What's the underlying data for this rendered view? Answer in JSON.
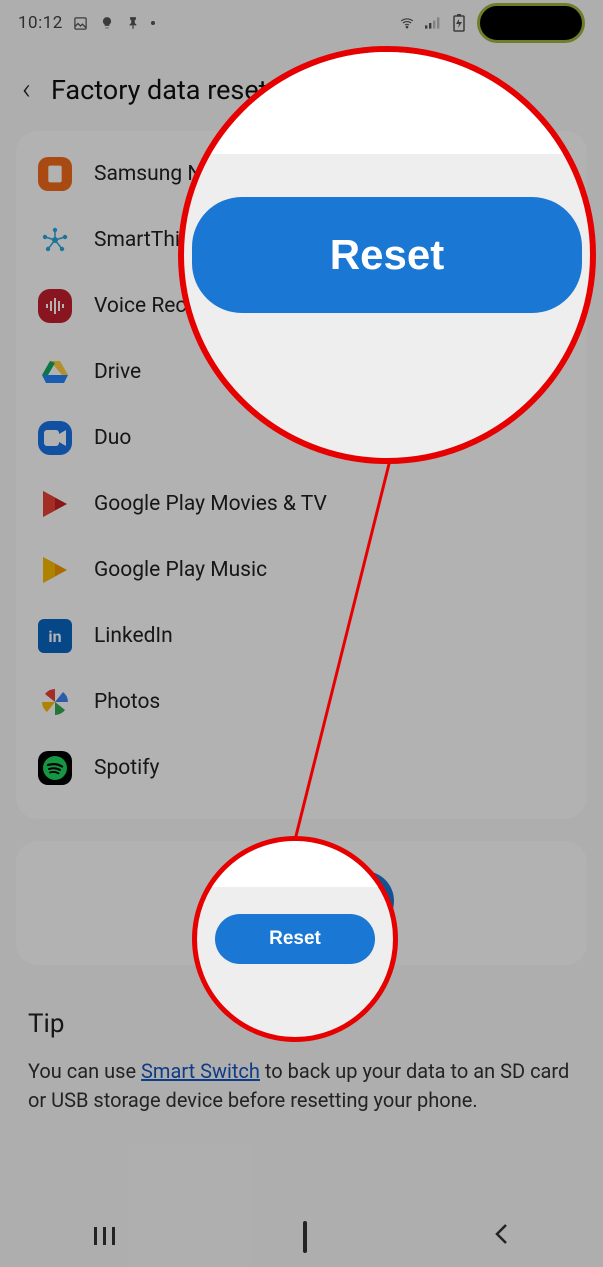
{
  "status": {
    "time": "10:12",
    "icons_left": [
      "image-icon",
      "bulb-icon",
      "pin-icon",
      "dot-icon"
    ],
    "icons_right": [
      "wifi-icon",
      "signal-icon",
      "charging-icon"
    ]
  },
  "header": {
    "title": "Factory data reset"
  },
  "apps": [
    {
      "id": "samsung-notes",
      "label": "Samsung Notes",
      "icon": "samsungnotes"
    },
    {
      "id": "smartthings",
      "label": "SmartThings",
      "icon": "smartthings"
    },
    {
      "id": "voice-recorder",
      "label": "Voice Recorder",
      "icon": "voicerec"
    },
    {
      "id": "drive",
      "label": "Drive",
      "icon": "drive"
    },
    {
      "id": "duo",
      "label": "Duo",
      "icon": "duo"
    },
    {
      "id": "play-movies",
      "label": "Google Play Movies & TV",
      "icon": "playmovies"
    },
    {
      "id": "play-music",
      "label": "Google Play Music",
      "icon": "playmusic"
    },
    {
      "id": "linkedin",
      "label": "LinkedIn",
      "icon": "linkedin"
    },
    {
      "id": "photos",
      "label": "Photos",
      "icon": "photos"
    },
    {
      "id": "spotify",
      "label": "Spotify",
      "icon": "spotify"
    }
  ],
  "reset": {
    "label": "Reset"
  },
  "tip": {
    "title": "Tip",
    "before": "You can use ",
    "link": "Smart Switch",
    "after": " to back up your data to an SD card or USB storage device before resetting your phone."
  },
  "nav": {
    "recents": "|||",
    "home": "◻",
    "back": "<"
  },
  "annotation": {
    "big_label": "Reset",
    "small_label": "Reset",
    "color": "#e60000"
  }
}
